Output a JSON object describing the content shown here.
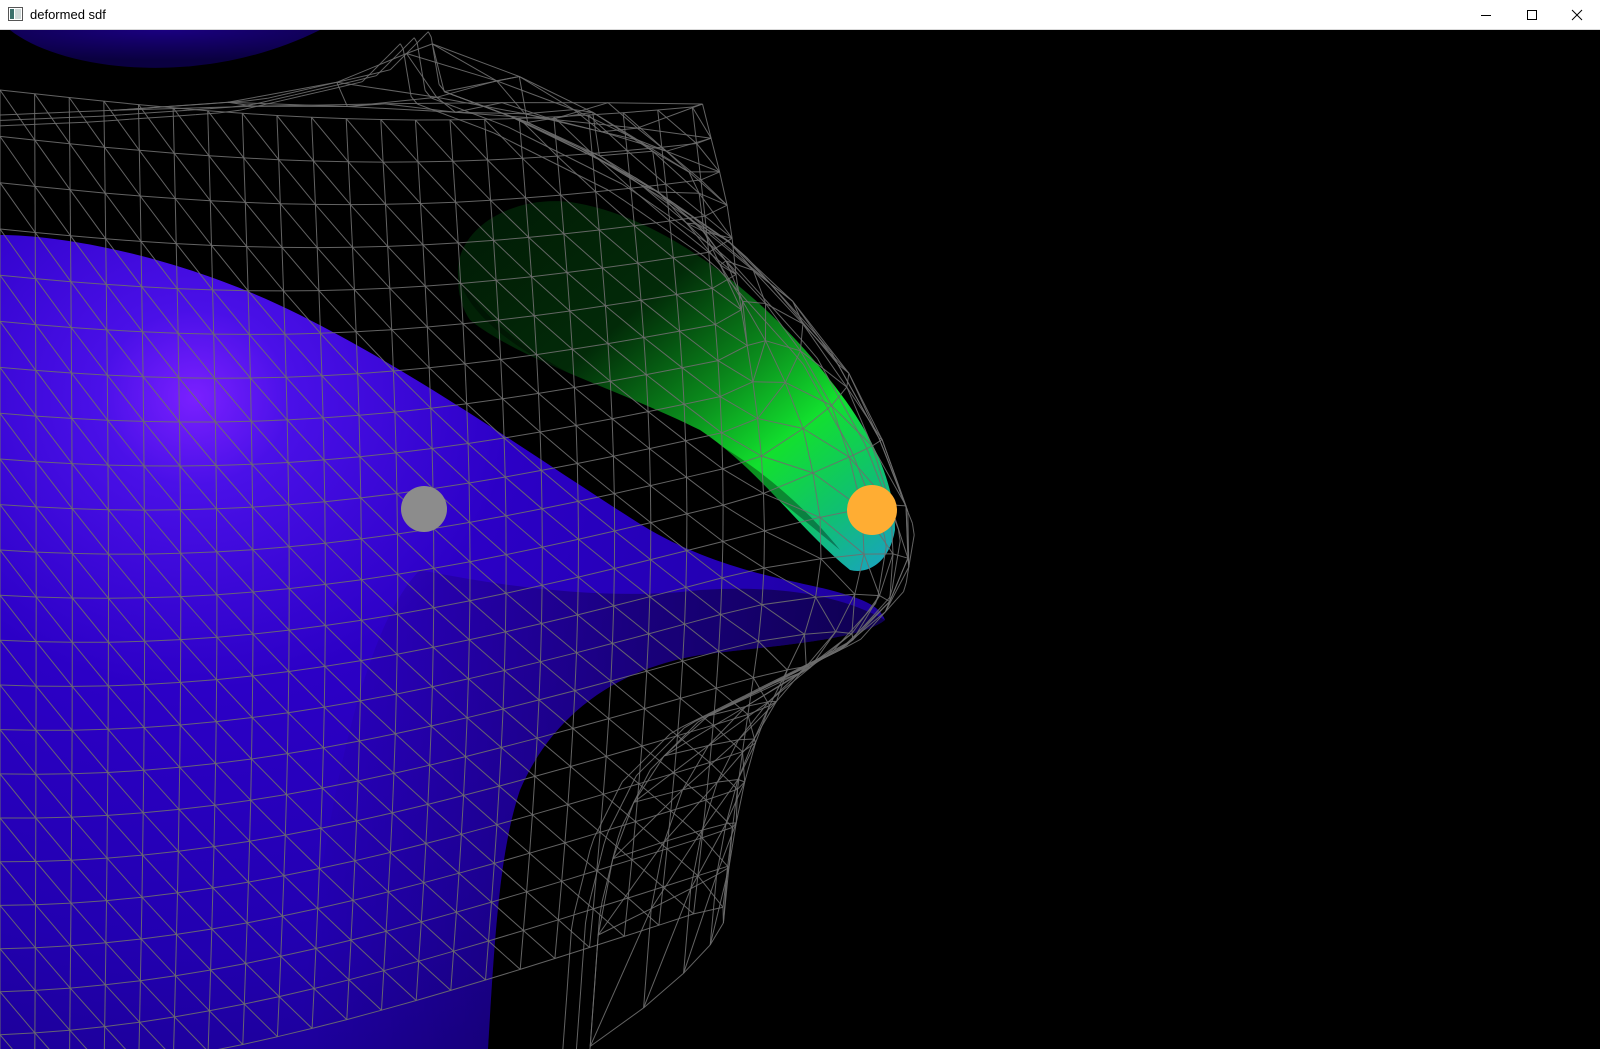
{
  "window": {
    "title": "deformed sdf",
    "app_icon": "window-app-icon",
    "controls": {
      "minimize_icon": "minimize-icon",
      "maximize_icon": "maximize-icon",
      "close_icon": "close-icon"
    }
  },
  "scene": {
    "background_color": "#000000",
    "wireframe_color": "#6e6e6e",
    "blue_surface_color": "#2a00c8",
    "green_surface_color": "#12e02e",
    "gray_marker_color": "#8c8c8c",
    "orange_marker_color": "#ffad33"
  }
}
